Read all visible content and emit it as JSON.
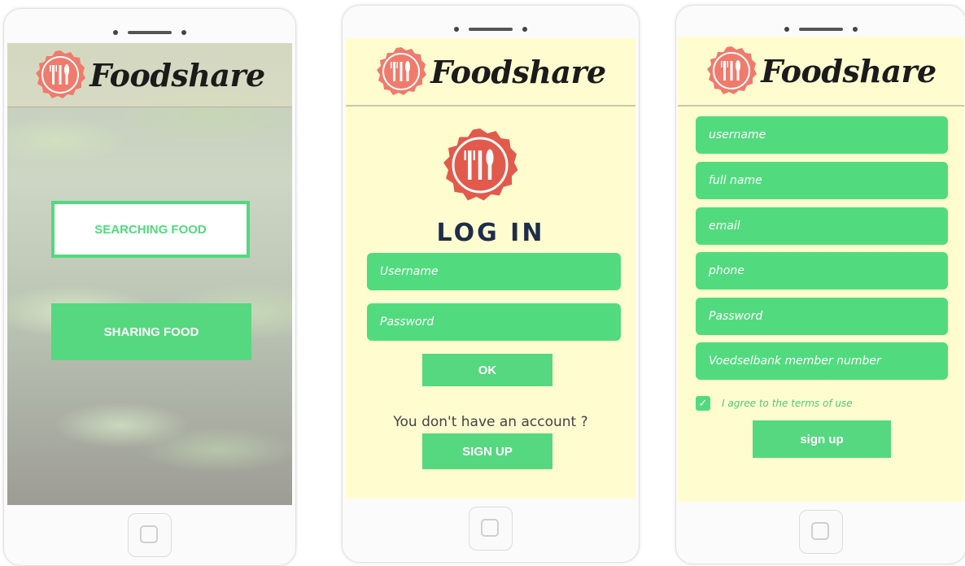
{
  "app": {
    "brand": "Foodshare"
  },
  "icons": {
    "logo": "fork-knife-spoon-badge-icon",
    "home": "home-button-icon",
    "check": "checkmark-icon"
  },
  "colors": {
    "accent": "#52db7e",
    "logo_red": "#e25a4b",
    "cream": "#fffdd0",
    "title_navy": "#1f2d4a"
  },
  "home_screen": {
    "searching_label": "SEARCHING FOOD",
    "sharing_label": "SHARING FOOD"
  },
  "login_screen": {
    "title": "LOG IN",
    "username_placeholder": "Username",
    "password_placeholder": "Password",
    "ok_label": "OK",
    "no_account_text": "You don't have an account ?",
    "signup_label": "SIGN UP"
  },
  "signup_screen": {
    "fields": [
      "username",
      "full name",
      "email",
      "phone",
      "Password",
      "Voedselbank member number"
    ],
    "agree_text": "I agree to the terms of use",
    "agree_checked": true,
    "signup_label": "sign up"
  }
}
